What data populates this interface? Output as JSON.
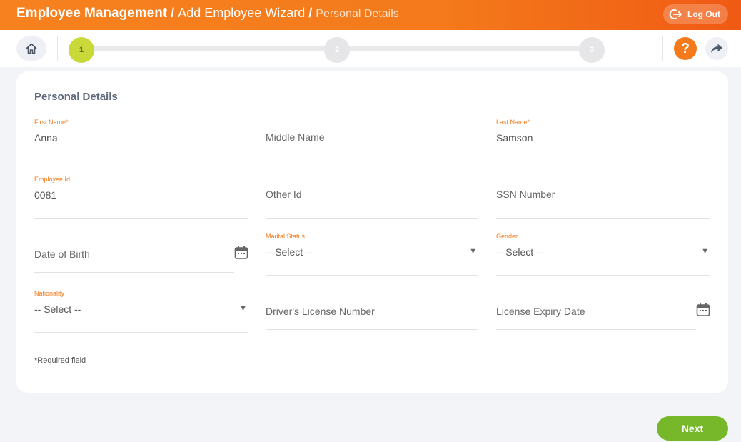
{
  "breadcrumb": {
    "module": "Employee Management",
    "wizard": "Add Employee Wizard",
    "page": "Personal Details",
    "separator": "/"
  },
  "header": {
    "logout_label": "Log Out"
  },
  "progress": {
    "steps": [
      "1",
      "2",
      "3"
    ],
    "active_step": 1,
    "help_label": "?"
  },
  "form": {
    "title": "Personal Details",
    "required_mark": "*",
    "fields": {
      "first_name": {
        "label": "First Name",
        "value": "Anna"
      },
      "middle_name": {
        "placeholder": "Middle Name"
      },
      "last_name": {
        "label": "Last Name",
        "value": "Samson"
      },
      "employee_id": {
        "label": "Employee Id",
        "value": "0081"
      },
      "other_id": {
        "placeholder": "Other Id"
      },
      "ssn": {
        "placeholder": "SSN Number"
      },
      "dob": {
        "placeholder": "Date of Birth"
      },
      "marital_status": {
        "label": "Marital Status",
        "value": "-- Select --"
      },
      "gender": {
        "label": "Gender",
        "value": "-- Select --"
      },
      "nationality": {
        "label": "Nationality",
        "value": "-- Select --"
      },
      "drivers_license": {
        "placeholder": "Driver's License Number"
      },
      "license_expiry": {
        "placeholder": "License Expiry Date"
      }
    },
    "required_note": "Required field",
    "caret": "▼"
  },
  "footer": {
    "next_label": "Next"
  },
  "colors": {
    "accent": "#f47a1b",
    "active_step": "#c9d93a",
    "next": "#76b82a"
  }
}
